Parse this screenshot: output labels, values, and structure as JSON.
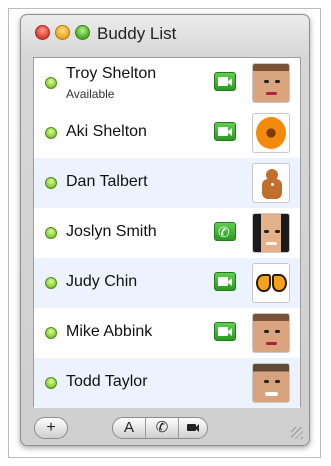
{
  "window": {
    "title": "Buddy List"
  },
  "buddies": [
    {
      "name": "Troy Shelton",
      "status_text": "Available",
      "status": "available",
      "capability": "video",
      "picture": "man-with-glasses-photo"
    },
    {
      "name": "Aki Shelton",
      "capability": "video",
      "picture": "orange-flower-icon"
    },
    {
      "name": "Dan Talbert",
      "capability": "none",
      "picture": "gingerbread-man-icon"
    },
    {
      "name": "Joslyn Smith",
      "capability": "audio",
      "picture": "woman-photo"
    },
    {
      "name": "Judy Chin",
      "capability": "video",
      "picture": "butterfly-icon"
    },
    {
      "name": "Mike Abbink",
      "capability": "video",
      "picture": "man-photo"
    },
    {
      "name": "Todd Taylor",
      "capability": "none",
      "picture": "smiling-man-photo"
    }
  ],
  "toolbar": {
    "add_label": "+",
    "text_chat_label": "A",
    "audio_chat_label": "✆",
    "video_chat_icon": "video-camera-icon"
  },
  "colors": {
    "status_available": "#8fd23a",
    "video_button": "#2c9a24",
    "row_alternate": "#edf3fe"
  }
}
